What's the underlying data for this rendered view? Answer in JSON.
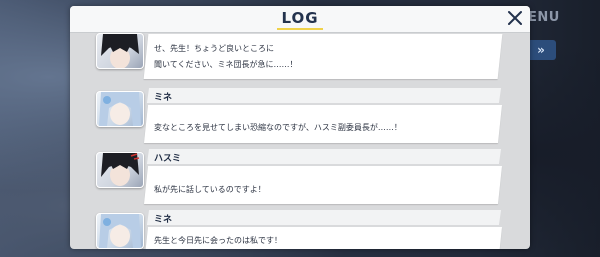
{
  "background": {
    "menu_hint": "ENU",
    "skip_hint": "»"
  },
  "panel": {
    "title": "LOG",
    "accent_color": "#f0d24a",
    "title_color": "#23324d"
  },
  "entries": [
    {
      "speaker": "",
      "portrait": "hasumi",
      "lines": [
        "せ、先生！ちょうど良いところに",
        "聞いてください、ミネ団長が急に……！"
      ]
    },
    {
      "speaker": "ミネ",
      "portrait": "mine",
      "lines": [
        "変なところを見せてしまい恐縮なのですが、ハスミ副委員長が……！"
      ]
    },
    {
      "speaker": "ハスミ",
      "portrait": "hasumi",
      "lines": [
        "私が先に話しているのですよ！"
      ]
    },
    {
      "speaker": "ミネ",
      "portrait": "mine",
      "lines": [
        "先生と今日先に会ったのは私です！"
      ]
    }
  ]
}
